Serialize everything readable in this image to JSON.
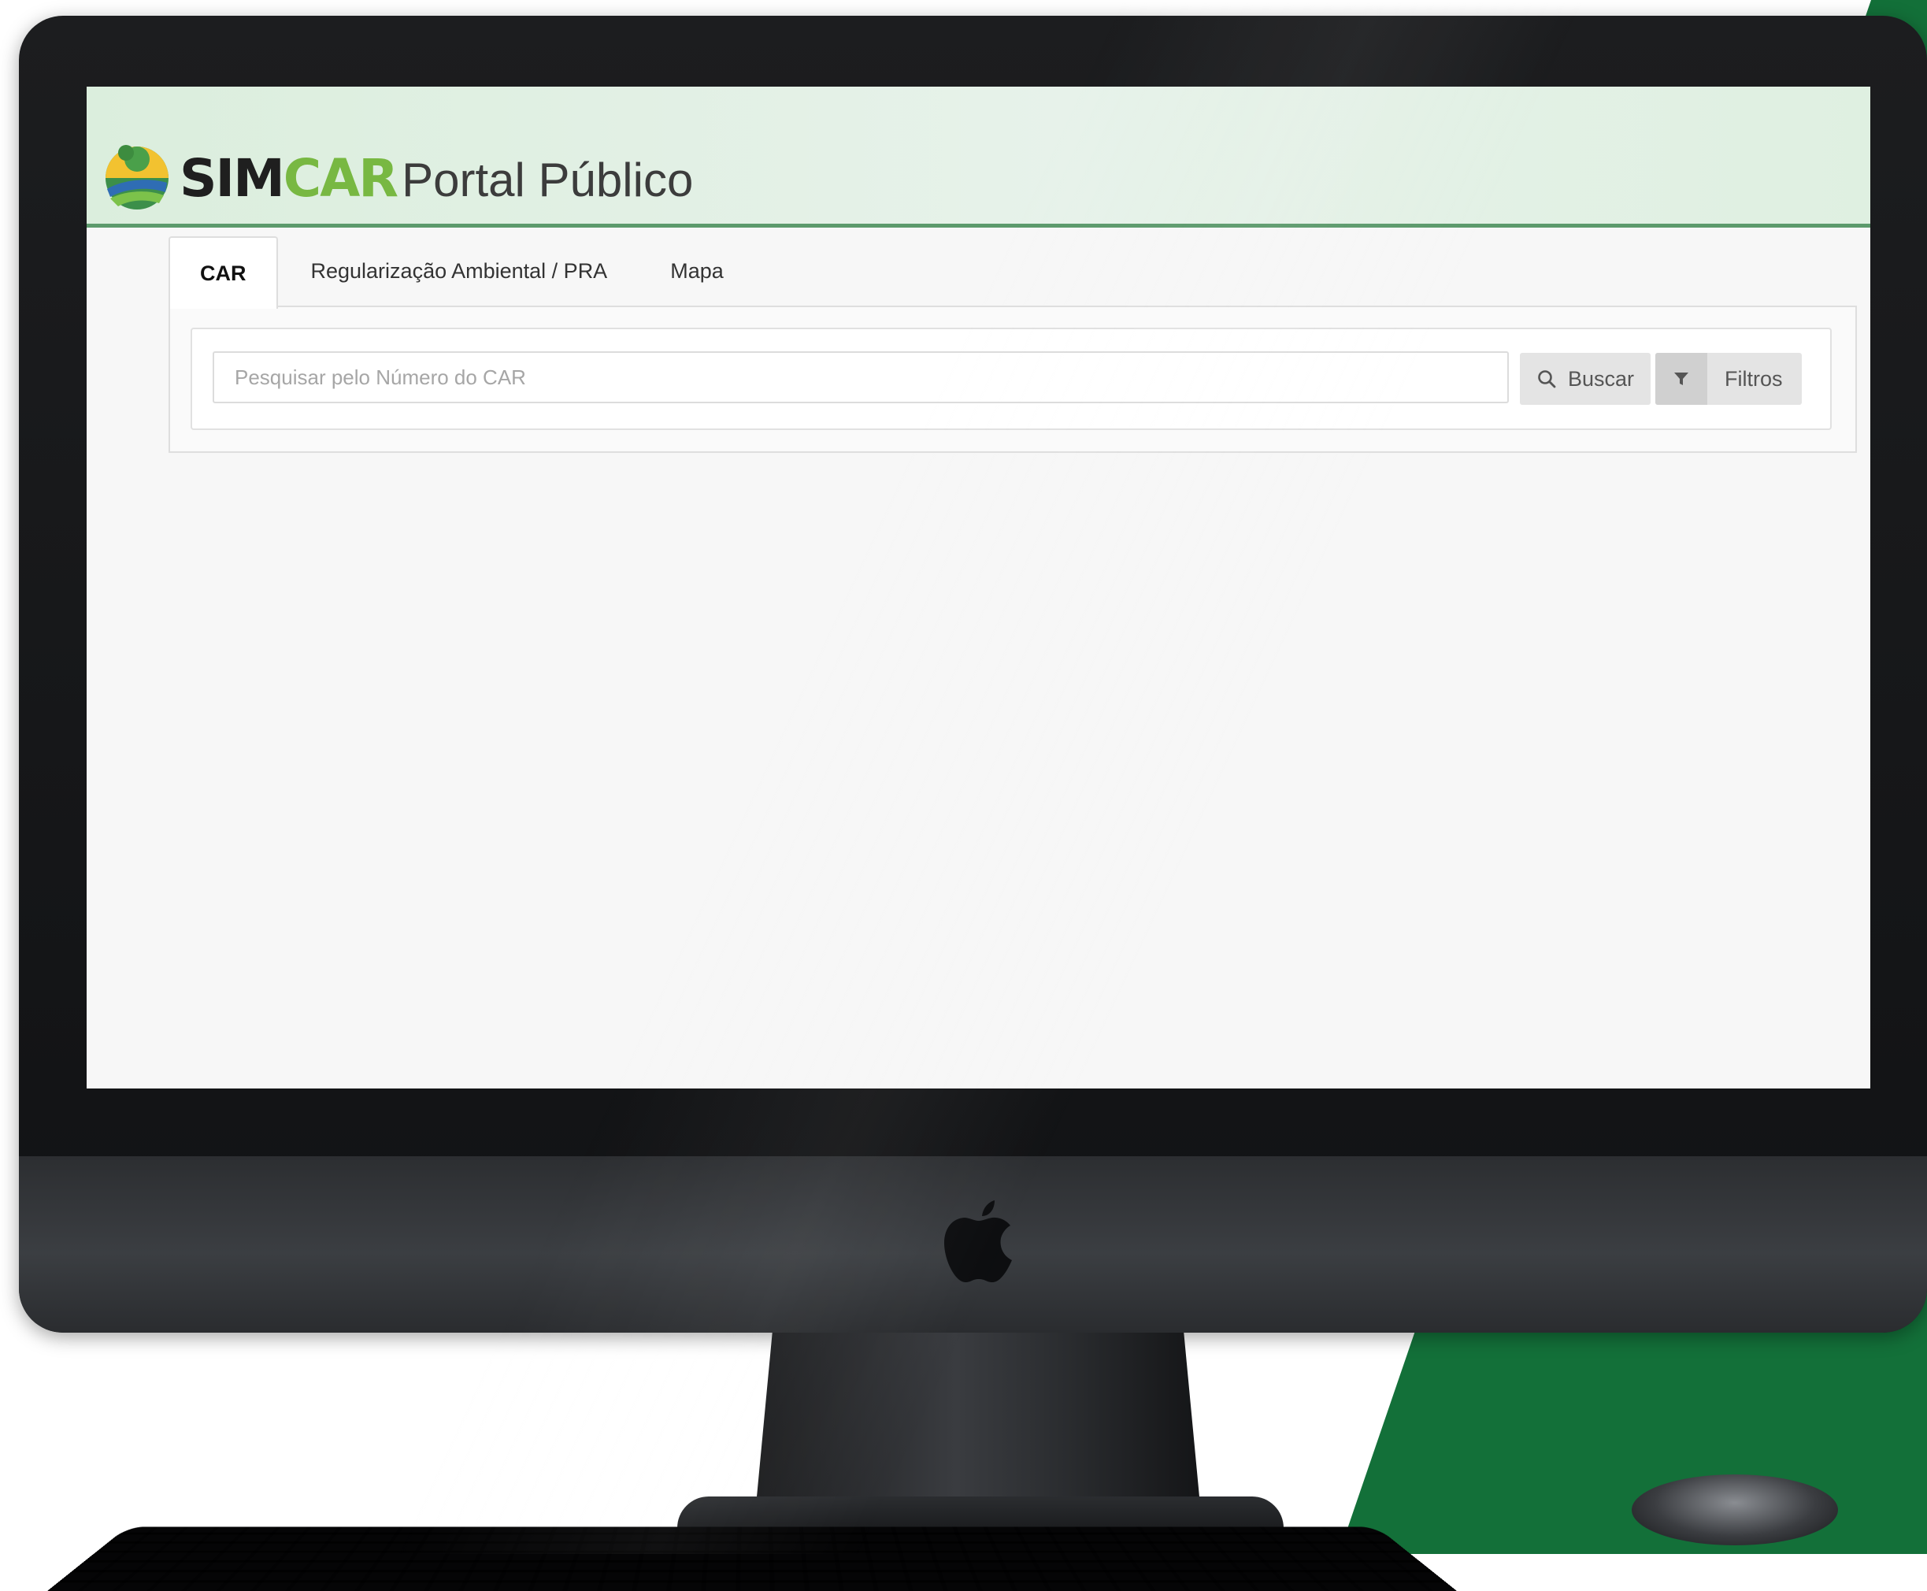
{
  "colors": {
    "accent_green": "#78b842",
    "header_border": "#5c9a6c",
    "background_green": "#137039"
  },
  "app": {
    "brand_sim": "SIM",
    "brand_car": "CAR",
    "brand_portal": "Portal Público",
    "logo_icon": "simcar-logo-icon"
  },
  "tabs": [
    {
      "label": "CAR",
      "active": true
    },
    {
      "label": "Regularização Ambiental / PRA",
      "active": false
    },
    {
      "label": "Mapa",
      "active": false
    }
  ],
  "search": {
    "placeholder": "Pesquisar pelo Número do CAR",
    "value": "",
    "buscar_label": "Buscar",
    "filtros_label": "Filtros",
    "buscar_icon": "search-icon",
    "filtros_icon": "filter-icon"
  }
}
